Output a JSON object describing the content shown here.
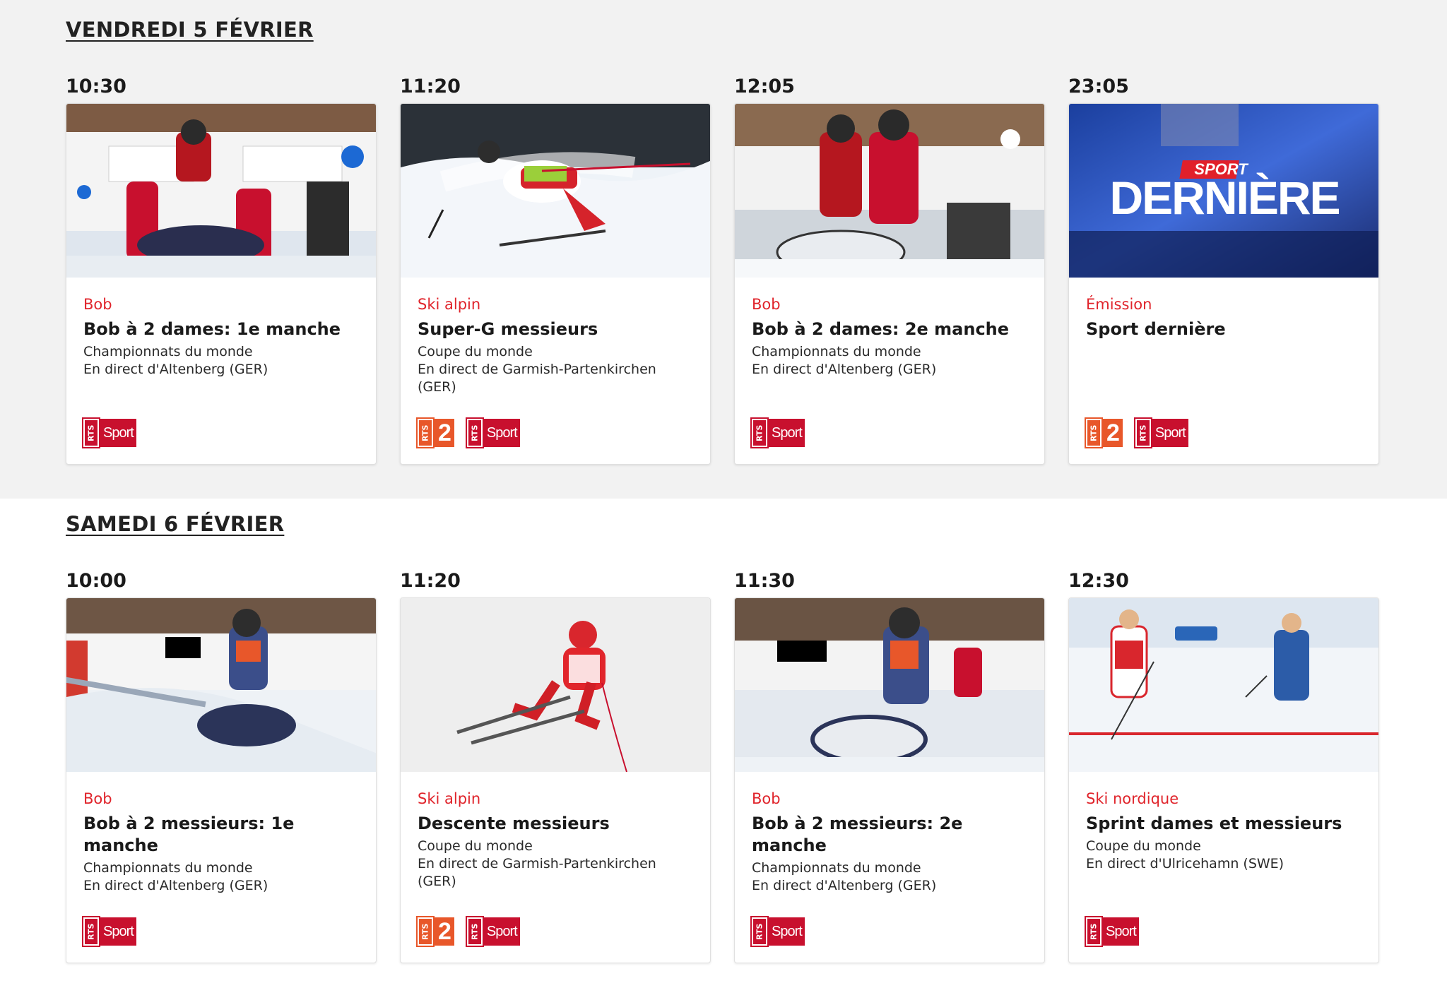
{
  "days": [
    {
      "heading": "VENDREDI 5 FÉVRIER",
      "slots": [
        {
          "time": "10:30",
          "category": "Bob",
          "title": "Bob à 2 dames: 1e manche",
          "lines": [
            "Championnats du monde",
            "En direct d'Altenberg (GER)"
          ],
          "channels": [
            "rts-sport"
          ],
          "image": "bobsleigh-start-photo"
        },
        {
          "time": "11:20",
          "category": "Ski alpin",
          "title": "Super-G messieurs",
          "lines": [
            "Coupe du monde",
            "En direct de Garmish-Partenkirchen",
            "(GER)"
          ],
          "channels": [
            "rts-2",
            "rts-sport"
          ],
          "image": "ski-racer-photo"
        },
        {
          "time": "12:05",
          "category": "Bob",
          "title": "Bob à 2 dames: 2e manche",
          "lines": [
            "Championnats du monde",
            "En direct d'Altenberg (GER)"
          ],
          "channels": [
            "rts-sport"
          ],
          "image": "bobsleigh-push-photo"
        },
        {
          "time": "23:05",
          "category": "Émission",
          "title": "Sport dernière",
          "lines": [],
          "channels": [
            "rts-2",
            "rts-sport"
          ],
          "image": "sport-derniere-studio",
          "show_badge": "SPORT",
          "show_name": "DERNIÈRE"
        }
      ]
    },
    {
      "heading": "SAMEDI 6 FÉVRIER",
      "slots": [
        {
          "time": "10:00",
          "category": "Bob",
          "title": "Bob à 2 messieurs: 1e manche",
          "lines": [
            "Championnats du monde",
            "En direct d'Altenberg (GER)"
          ],
          "channels": [
            "rts-sport"
          ],
          "image": "bobsleigh-men-photo"
        },
        {
          "time": "11:20",
          "category": "Ski alpin",
          "title": "Descente messieurs",
          "lines": [
            "Coupe du monde",
            "En direct de Garmish-Partenkirchen",
            "(GER)"
          ],
          "channels": [
            "rts-2",
            "rts-sport"
          ],
          "image": "downhill-jump-photo"
        },
        {
          "time": "11:30",
          "category": "Bob",
          "title": "Bob à 2 messieurs: 2e manche",
          "lines": [
            "Championnats du monde",
            "En direct d'Altenberg (GER)"
          ],
          "channels": [
            "rts-sport"
          ],
          "image": "bobsleigh-men-push-photo"
        },
        {
          "time": "12:30",
          "category": "Ski nordique",
          "title": "Sprint dames et messieurs",
          "lines": [
            "Coupe du monde",
            "En direct d'Ulricehamn (SWE)"
          ],
          "channels": [
            "rts-sport"
          ],
          "image": "nordic-sprint-photo"
        }
      ]
    }
  ],
  "channel_labels": {
    "rts_tag": "RTS",
    "sport": "Sport",
    "two": "2"
  },
  "colors": {
    "accent_red": "#e0242b",
    "rts_sport_red": "#c8102e",
    "rts2_orange": "#e8572a"
  }
}
